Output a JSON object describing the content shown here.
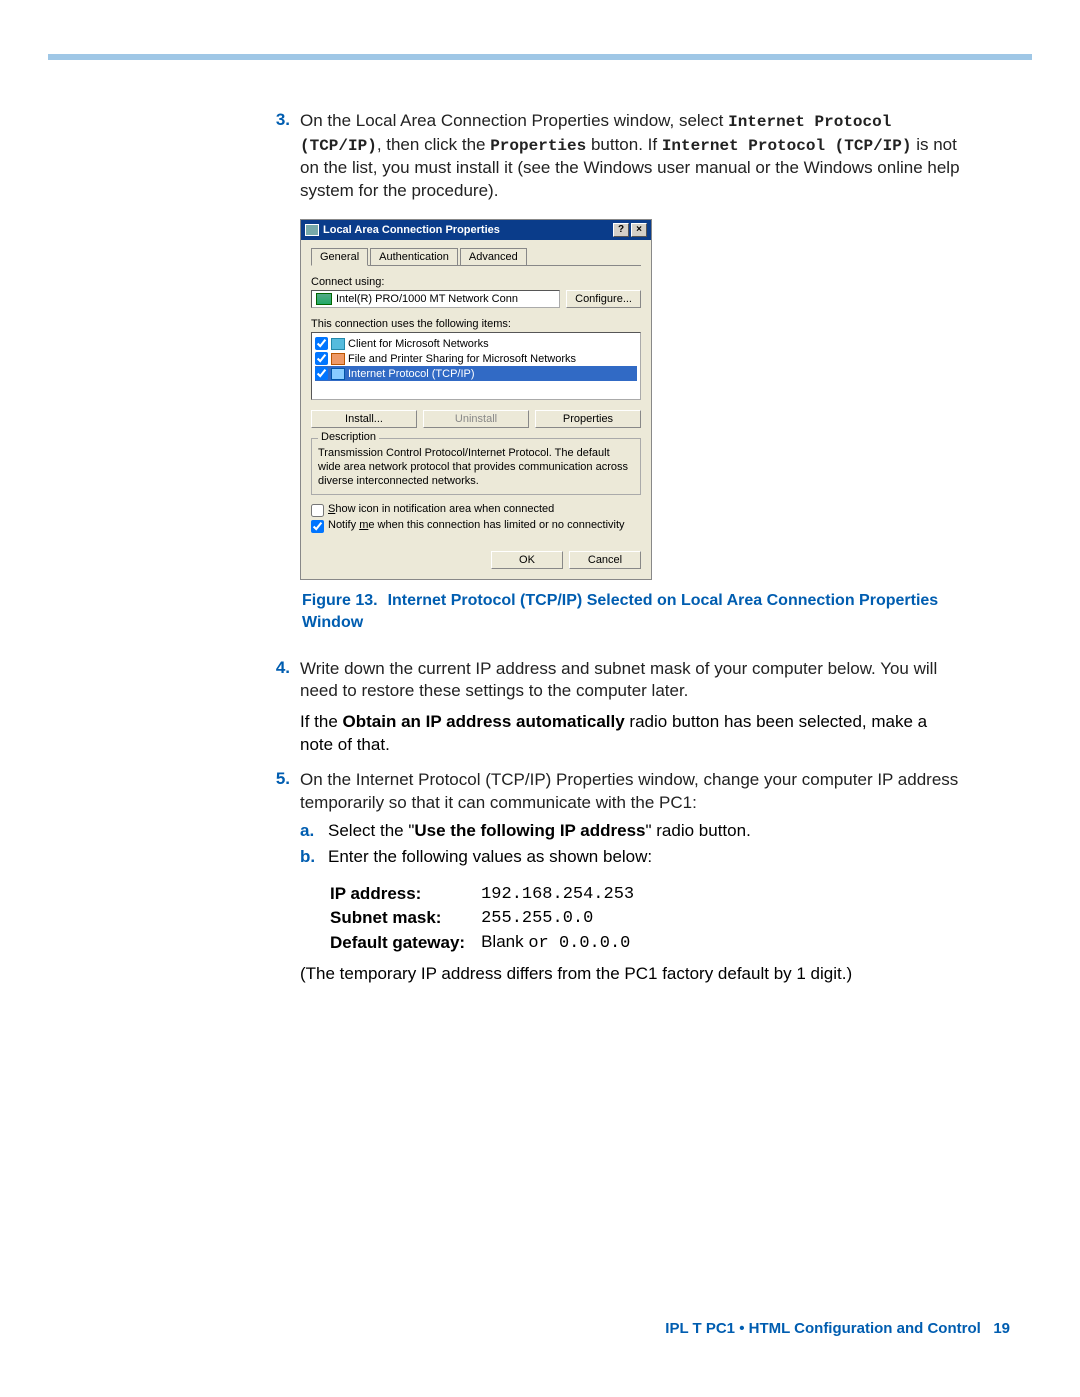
{
  "step3": {
    "num": "3.",
    "text_a": "On the Local Area Connection Properties window, select ",
    "mono1": "Internet Protocol (TCP/IP)",
    "text_b": ", then click the ",
    "mono2": "Properties",
    "text_c": " button. If ",
    "mono3": "Internet Protocol (TCP/IP)",
    "text_d": " is not on the list, you must install it (see the Windows user manual or the Windows online help system for the procedure)."
  },
  "dialog": {
    "title": "Local Area Connection Properties",
    "help_btn": "?",
    "close_btn": "×",
    "tabs": [
      "General",
      "Authentication",
      "Advanced"
    ],
    "connect_using_label": "Connect using:",
    "adapter": "Intel(R) PRO/1000 MT Network Conn",
    "configure_btn": "Configure...",
    "items_label": "This connection uses the following items:",
    "items": [
      {
        "checked": true,
        "label": "Client for Microsoft Networks"
      },
      {
        "checked": true,
        "label": "File and Printer Sharing for Microsoft Networks"
      },
      {
        "checked": true,
        "label": "Internet Protocol (TCP/IP)",
        "selected": true
      }
    ],
    "install_btn": "Install...",
    "uninstall_btn": "Uninstall",
    "properties_btn": "Properties",
    "desc_legend": "Description",
    "desc_text": "Transmission Control Protocol/Internet Protocol. The default wide area network protocol that provides communication across diverse interconnected networks.",
    "show_icon_label": "Show icon in notification area when connected",
    "notify_label": "Notify me when this connection has limited or no connectivity",
    "notify_checked": true,
    "ok_btn": "OK",
    "cancel_btn": "Cancel"
  },
  "figure": {
    "label": "Figure 13.",
    "text": "Internet Protocol (TCP/IP) Selected on Local Area Connection Properties Window"
  },
  "step4": {
    "num": "4.",
    "text": "Write down the current IP address and subnet mask of your computer below. You will need to restore these settings to the computer later.",
    "para2_a": "If the ",
    "para2_mono": "Obtain an IP address automatically",
    "para2_b": " radio button has been selected, make a note of that."
  },
  "step5": {
    "num": "5.",
    "text": "On the Internet Protocol (TCP/IP) Properties window, change your computer IP address temporarily so that it can communicate with the PC1:",
    "sub_a": {
      "num": "a.",
      "text_a": "Select the \"",
      "mono": "Use the following IP address",
      "text_b": "\" radio button."
    },
    "sub_b": {
      "num": "b.",
      "text": "Enter the following values as shown below:"
    },
    "table": {
      "ip_label": "IP address:",
      "ip_value": "192.168.254.253",
      "mask_label": "Subnet mask:",
      "mask_value": "255.255.0.0",
      "gw_label": "Default gateway:",
      "gw_value_a": "Blank ",
      "gw_value_mono": "or 0.0.0.0"
    },
    "note": "(The temporary IP address differs from the PC1 factory default by 1 digit.)"
  },
  "footer": {
    "text": "IPL T PC1 • HTML Configuration and Control",
    "page": "19"
  }
}
